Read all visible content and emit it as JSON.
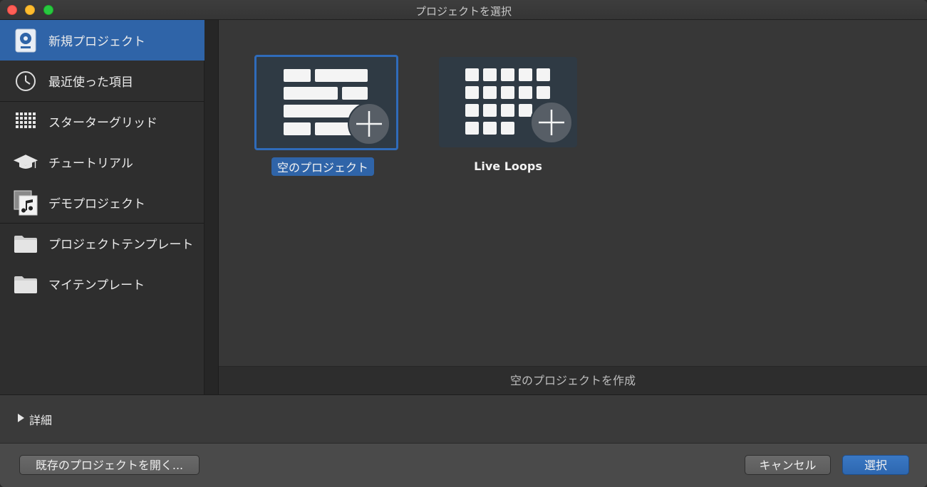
{
  "window": {
    "title": "プロジェクトを選択"
  },
  "sidebar": {
    "items": [
      {
        "label": "新規プロジェクト",
        "icon": "new-project-icon"
      },
      {
        "label": "最近使った項目",
        "icon": "clock-icon"
      },
      {
        "label": "スターターグリッド",
        "icon": "grid-icon"
      },
      {
        "label": "チュートリアル",
        "icon": "graduation-cap-icon"
      },
      {
        "label": "デモプロジェクト",
        "icon": "music-note-icon"
      },
      {
        "label": "プロジェクトテンプレート",
        "icon": "folder-icon"
      },
      {
        "label": "マイテンプレート",
        "icon": "folder-icon"
      }
    ]
  },
  "main": {
    "tiles": [
      {
        "label": "空のプロジェクト",
        "icon": "tracks-plus-icon"
      },
      {
        "label": "Live Loops",
        "icon": "grid-plus-icon"
      }
    ]
  },
  "status": {
    "text": "空のプロジェクトを作成"
  },
  "details": {
    "label": "詳細"
  },
  "footer": {
    "open_label": "既存のプロジェクトを開く...",
    "cancel_label": "キャンセル",
    "choose_label": "選択"
  },
  "colors": {
    "accent": "#2f64a8",
    "background": "#353535"
  }
}
